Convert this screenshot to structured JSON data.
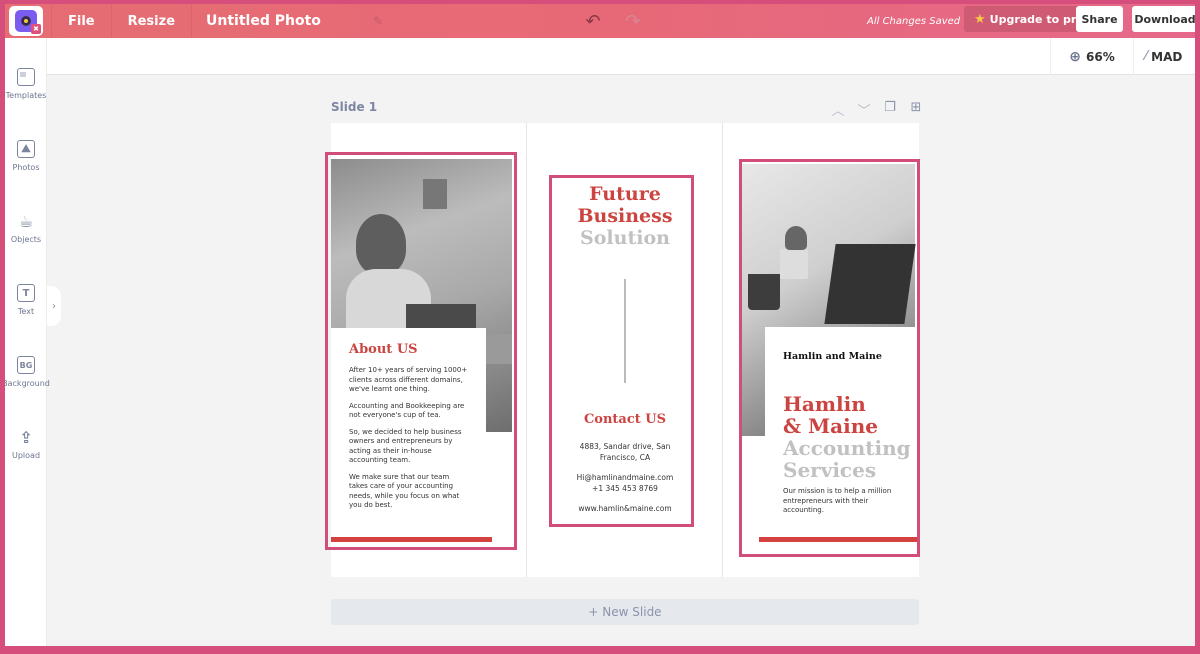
{
  "topbar": {
    "file_label": "File",
    "resize_label": "Resize",
    "document_title": "Untitled Photo",
    "save_status": "All Changes Saved",
    "upgrade_label": "Upgrade to pro",
    "share_label": "Share",
    "download_label": "Download",
    "icons": {
      "edit": "pencil-icon",
      "undo": "undo-icon",
      "redo": "redo-icon",
      "star": "star-icon"
    }
  },
  "subbar": {
    "zoom_level": "66%",
    "magic_label": "MAD"
  },
  "sidebar": {
    "items": [
      {
        "label": "Templates",
        "icon": "templates-icon"
      },
      {
        "label": "Photos",
        "icon": "photos-icon"
      },
      {
        "label": "Objects",
        "icon": "objects-icon"
      },
      {
        "label": "Text",
        "icon": "text-icon"
      },
      {
        "label": "Background",
        "icon": "background-icon"
      },
      {
        "label": "Upload",
        "icon": "upload-icon"
      }
    ]
  },
  "slide": {
    "label": "Slide 1",
    "panel1": {
      "heading": "About US",
      "paragraphs": [
        "After 10+ years of serving 1000+ clients across different domains, we've learnt one thing.",
        "Accounting and Bookkeeping are not everyone's cup of tea.",
        "So, we decided to help business owners and entrepreneurs by acting as their in-house accounting team.",
        "We make sure that our team takes care of your accounting needs, while you focus on what you do best."
      ]
    },
    "panel2": {
      "title_line1": "Future",
      "title_line2": "Business",
      "title_line3": "Solution",
      "contact_heading": "Contact US",
      "address": "4883, Sandar drive, San Francisco, CA",
      "email": "Hi@hamlinandmaine.com",
      "phone": "+1 345 453 8769",
      "website": "www.hamlin&maine.com"
    },
    "panel3": {
      "brand": "Hamlin and Maine",
      "title_line1": "Hamlin",
      "title_line2": "& Maine",
      "title_line3": "Accounting",
      "title_line4": "Services",
      "mission": "Our mission is to help a million entrepreneurs with their accounting."
    }
  },
  "new_slide_label": "+ New Slide",
  "colors": {
    "accent_pink": "#d64e7b",
    "topbar_coral": "#e76977",
    "brochure_red": "#cc4440",
    "muted_grey": "#c1c1c1"
  }
}
